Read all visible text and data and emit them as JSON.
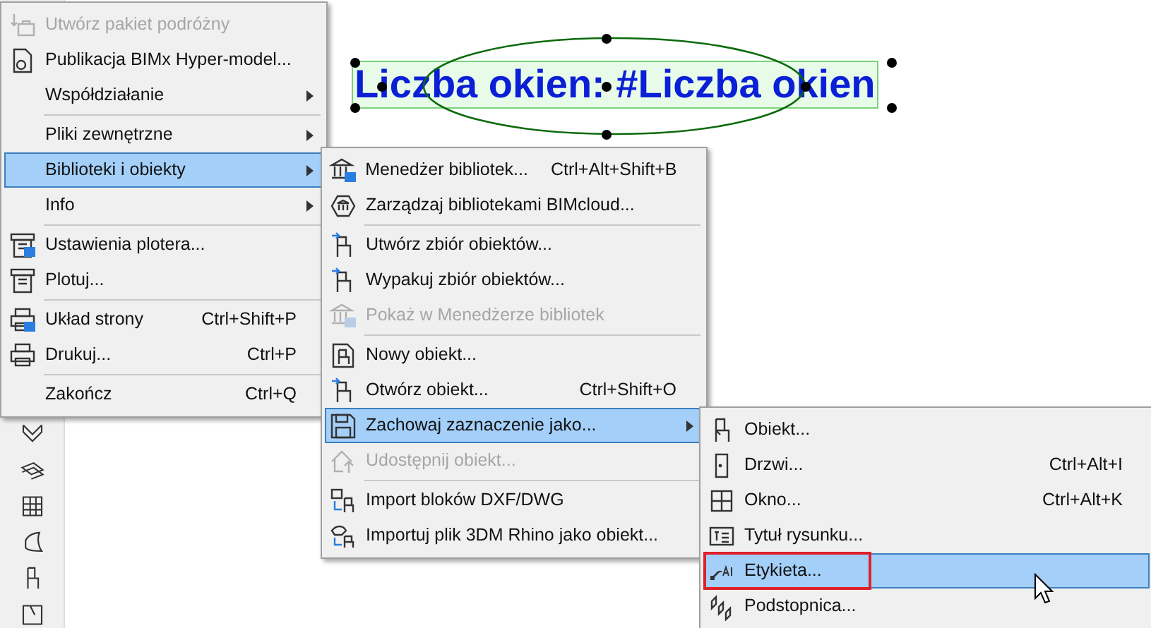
{
  "canvas": {
    "label": "Liczba okien: #Liczba okien"
  },
  "menu": {
    "items": [
      {
        "label": "Utwórz pakiet podróżny",
        "disabled": true,
        "selected": false,
        "separator_before": false,
        "submenu": false
      },
      {
        "label": "Publikacja BIMx Hyper-model...",
        "disabled": false,
        "selected": false,
        "separator_before": false,
        "submenu": false
      },
      {
        "label": "Współdziałanie",
        "disabled": false,
        "selected": false,
        "separator_before": false,
        "submenu": true
      },
      {
        "label": "Pliki zewnętrzne",
        "disabled": false,
        "selected": false,
        "separator_before": true,
        "submenu": true
      },
      {
        "label": "Biblioteki i obiekty",
        "disabled": false,
        "selected": true,
        "separator_before": false,
        "submenu": true
      },
      {
        "label": "Info",
        "disabled": false,
        "selected": false,
        "separator_before": false,
        "submenu": true
      },
      {
        "label": "Ustawienia plotera...",
        "disabled": false,
        "selected": false,
        "separator_before": true,
        "submenu": false
      },
      {
        "label": "Plotuj...",
        "disabled": false,
        "selected": false,
        "separator_before": false,
        "submenu": false
      },
      {
        "label": "Układ strony",
        "shortcut": "Ctrl+Shift+P",
        "disabled": false,
        "selected": false,
        "separator_before": true,
        "submenu": false
      },
      {
        "label": "Drukuj...",
        "shortcut": "Ctrl+P",
        "disabled": false,
        "selected": false,
        "separator_before": false,
        "submenu": false
      },
      {
        "label": "Zakończ",
        "shortcut": "Ctrl+Q",
        "disabled": false,
        "selected": false,
        "separator_before": true,
        "submenu": false
      }
    ]
  },
  "submenu": {
    "items": [
      {
        "label": "Menedżer bibliotek...",
        "shortcut": "Ctrl+Alt+Shift+B",
        "disabled": false,
        "selected": false,
        "separator_before": false,
        "submenu": false
      },
      {
        "label": "Zarządzaj bibliotekami BIMcloud...",
        "disabled": false,
        "selected": false,
        "separator_before": false,
        "submenu": false
      },
      {
        "label": "Utwórz zbiór obiektów...",
        "disabled": false,
        "selected": false,
        "separator_before": true,
        "submenu": false
      },
      {
        "label": "Wypakuj zbiór obiektów...",
        "disabled": false,
        "selected": false,
        "separator_before": false,
        "submenu": false
      },
      {
        "label": "Pokaż w Menedżerze bibliotek",
        "disabled": true,
        "selected": false,
        "separator_before": false,
        "submenu": false
      },
      {
        "label": "Nowy obiekt...",
        "disabled": false,
        "selected": false,
        "separator_before": true,
        "submenu": false
      },
      {
        "label": "Otwórz obiekt...",
        "shortcut": "Ctrl+Shift+O",
        "disabled": false,
        "selected": false,
        "separator_before": false,
        "submenu": false
      },
      {
        "label": "Zachowaj zaznaczenie jako...",
        "disabled": false,
        "selected": true,
        "separator_before": false,
        "submenu": true
      },
      {
        "label": "Udostępnij obiekt...",
        "disabled": true,
        "selected": false,
        "separator_before": false,
        "submenu": false
      },
      {
        "label": "Import bloków DXF/DWG",
        "disabled": false,
        "selected": false,
        "separator_before": true,
        "submenu": false
      },
      {
        "label": "Importuj plik 3DM Rhino jako obiekt...",
        "disabled": false,
        "selected": false,
        "separator_before": false,
        "submenu": false
      }
    ]
  },
  "submenu_2": {
    "items": [
      {
        "label": "Obiekt...",
        "disabled": false,
        "selected": false,
        "separator_before": false,
        "submenu": false,
        "outlined": false
      },
      {
        "label": "Drzwi...",
        "shortcut": "Ctrl+Alt+I",
        "disabled": false,
        "selected": false,
        "separator_before": false,
        "submenu": false,
        "outlined": false
      },
      {
        "label": "Okno...",
        "shortcut": "Ctrl+Alt+K",
        "disabled": false,
        "selected": false,
        "separator_before": false,
        "submenu": false,
        "outlined": false
      },
      {
        "label": "Tytuł rysunku...",
        "disabled": false,
        "selected": false,
        "separator_before": false,
        "submenu": false,
        "outlined": false
      },
      {
        "label": "Etykieta...",
        "disabled": false,
        "selected": true,
        "separator_before": false,
        "submenu": false,
        "outlined": true
      },
      {
        "label": "Podstopnica...",
        "disabled": false,
        "selected": false,
        "separator_before": false,
        "submenu": false,
        "outlined": false
      }
    ]
  }
}
